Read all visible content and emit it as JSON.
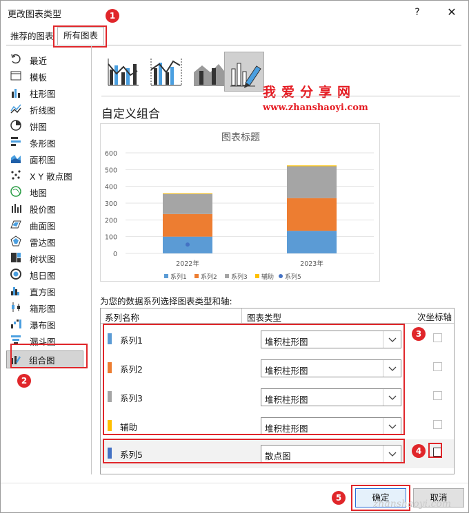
{
  "dialog": {
    "title": "更改图表类型",
    "help": "?",
    "close": "✕"
  },
  "tabs": [
    "推荐的图表",
    "所有图表"
  ],
  "sidebar": {
    "items": [
      {
        "label": "最近",
        "icon": "recent-icon"
      },
      {
        "label": "模板",
        "icon": "template-icon"
      },
      {
        "label": "柱形图",
        "icon": "column-chart-icon"
      },
      {
        "label": "折线图",
        "icon": "line-chart-icon"
      },
      {
        "label": "饼图",
        "icon": "pie-chart-icon"
      },
      {
        "label": "条形图",
        "icon": "bar-chart-icon"
      },
      {
        "label": "面积图",
        "icon": "area-chart-icon"
      },
      {
        "label": "X Y 散点图",
        "icon": "scatter-chart-icon"
      },
      {
        "label": "地图",
        "icon": "map-chart-icon"
      },
      {
        "label": "股价图",
        "icon": "stock-chart-icon"
      },
      {
        "label": "曲面图",
        "icon": "surface-chart-icon"
      },
      {
        "label": "雷达图",
        "icon": "radar-chart-icon"
      },
      {
        "label": "树状图",
        "icon": "treemap-chart-icon"
      },
      {
        "label": "旭日图",
        "icon": "sunburst-chart-icon"
      },
      {
        "label": "直方图",
        "icon": "histogram-chart-icon"
      },
      {
        "label": "箱形图",
        "icon": "boxwhisker-chart-icon"
      },
      {
        "label": "瀑布图",
        "icon": "waterfall-chart-icon"
      },
      {
        "label": "漏斗图",
        "icon": "funnel-chart-icon"
      },
      {
        "label": "组合图",
        "icon": "combo-chart-icon"
      }
    ]
  },
  "main": {
    "combo_title": "自定义组合",
    "watermark_title": "我爱分享网",
    "watermark_url": "www.zhanshaoyi.com",
    "assign_label": "为您的数据系列选择图表类型和轴:",
    "columns": [
      "系列名称",
      "图表类型",
      "次坐标轴"
    ]
  },
  "chart_data": {
    "type": "bar",
    "title": "图表标题",
    "categories": [
      "2022年",
      "2023年"
    ],
    "ylim": [
      0,
      600
    ],
    "yticks": [
      "0",
      "100",
      "200",
      "300",
      "400",
      "500",
      "600"
    ],
    "series": [
      {
        "name": "系列1",
        "values": [
          100,
          135
        ],
        "color": "#5b9bd5"
      },
      {
        "name": "系列2",
        "values": [
          135,
          195
        ],
        "color": "#ed7d31"
      },
      {
        "name": "系列3",
        "values": [
          120,
          190
        ],
        "color": "#a5a5a5"
      },
      {
        "name": "辅助",
        "values": [
          4,
          5
        ],
        "color": "#ffc000"
      }
    ],
    "scatter": {
      "name": "系列5",
      "points": [
        {
          "x": "2022年",
          "y": 53
        }
      ],
      "color": "#4472c4"
    },
    "legend": "bottom"
  },
  "series_rows": [
    {
      "name": "系列1",
      "chart_type": "堆积柱形图",
      "color": "#5b9bd5"
    },
    {
      "name": "系列2",
      "chart_type": "堆积柱形图",
      "color": "#ed7d31"
    },
    {
      "name": "系列3",
      "chart_type": "堆积柱形图",
      "color": "#a5a5a5"
    },
    {
      "name": "辅助",
      "chart_type": "堆积柱形图",
      "color": "#ffc000"
    },
    {
      "name": "系列5",
      "chart_type": "散点图",
      "color": "#4472c4"
    }
  ],
  "badges": [
    "1",
    "2",
    "3",
    "4",
    "5"
  ],
  "buttons": {
    "ok": "确定",
    "cancel": "取消"
  },
  "watermark_bottom": "zhanshaoyi.com"
}
